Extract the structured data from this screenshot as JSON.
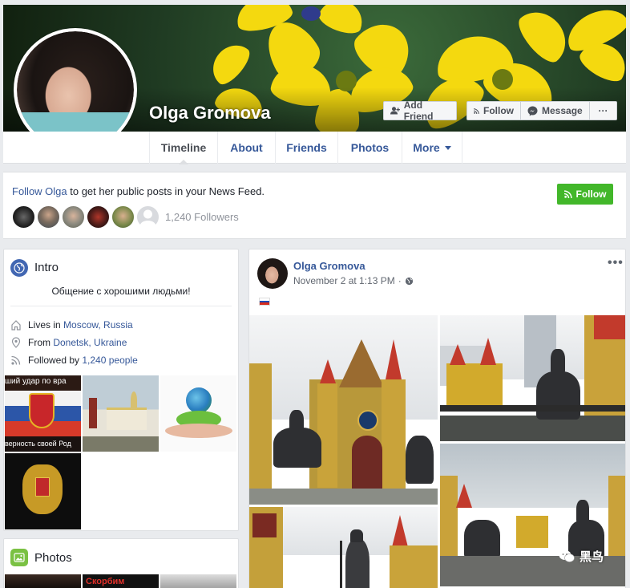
{
  "profile": {
    "name": "Olga Gromova",
    "actions": {
      "add_friend": "Add Friend",
      "follow": "Follow",
      "message": "Message",
      "more": "···"
    }
  },
  "nav": {
    "tabs": [
      "Timeline",
      "About",
      "Friends",
      "Photos",
      "More"
    ]
  },
  "follow_strip": {
    "link": "Follow Olga",
    "text": " to get her public posts in your News Feed.",
    "button": "Follow",
    "followers": "1,240 Followers"
  },
  "intro": {
    "title": "Intro",
    "bio": "Общение с хорошими людьми!",
    "lives_in_prefix": "Lives in ",
    "lives_in": "Moscow, Russia",
    "from_prefix": "From ",
    "from": "Donetsk, Ukraine",
    "followed_prefix": "Followed by ",
    "followed": "1,240 people",
    "photo_captions": [
      "ший удар по вра",
      "верность своей Род"
    ]
  },
  "photos": {
    "title": "Photos",
    "thumb_caption": "Скорбим"
  },
  "post": {
    "author": "Olga Gromova",
    "date": "November 2 at 1:13 PM",
    "separator": "·",
    "more": "•••"
  },
  "watermark": "黑鸟",
  "colors": {
    "link": "#365899",
    "brand": "#4267b2",
    "follow_green": "#42b72a"
  }
}
